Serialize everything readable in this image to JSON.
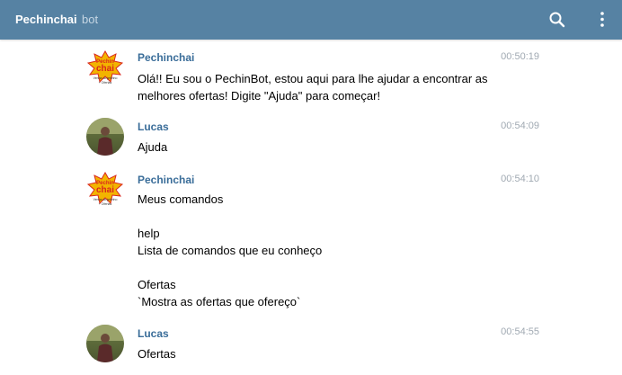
{
  "header": {
    "title": "Pechinchai",
    "subtitle": "bot",
    "search_icon": "search-icon",
    "more_icon": "more-vertical-icon"
  },
  "messages": [
    {
      "author": "Pechinchai",
      "time": "00:50:19",
      "text": "Olá!! Eu sou o PechinBot, estou aqui para lhe ajudar a encontrar as melhores ofertas! Digite \"Ajuda\" para começar!"
    },
    {
      "author": "Lucas",
      "time": "00:54:09",
      "text": "Ajuda"
    },
    {
      "author": "Pechinchai",
      "time": "00:54:10",
      "lines": [
        "Meus comandos",
        "help",
        "Lista de comandos que eu conheço",
        "Ofertas",
        "`Mostra as ofertas que ofereço`"
      ]
    },
    {
      "author": "Lucas",
      "time": "00:54:55",
      "text": "Ofertas"
    }
  ],
  "bot_logo": {
    "top": "Pechin",
    "main": "chai",
    "tagline": "Venha do jeitinho",
    "tagline2": "+ Ofertas"
  },
  "colors": {
    "header": "#5682a3",
    "author": "#3a6d99",
    "time": "#a0a9b2",
    "logo_gold": "#f2b400",
    "logo_red": "#d9261c"
  }
}
